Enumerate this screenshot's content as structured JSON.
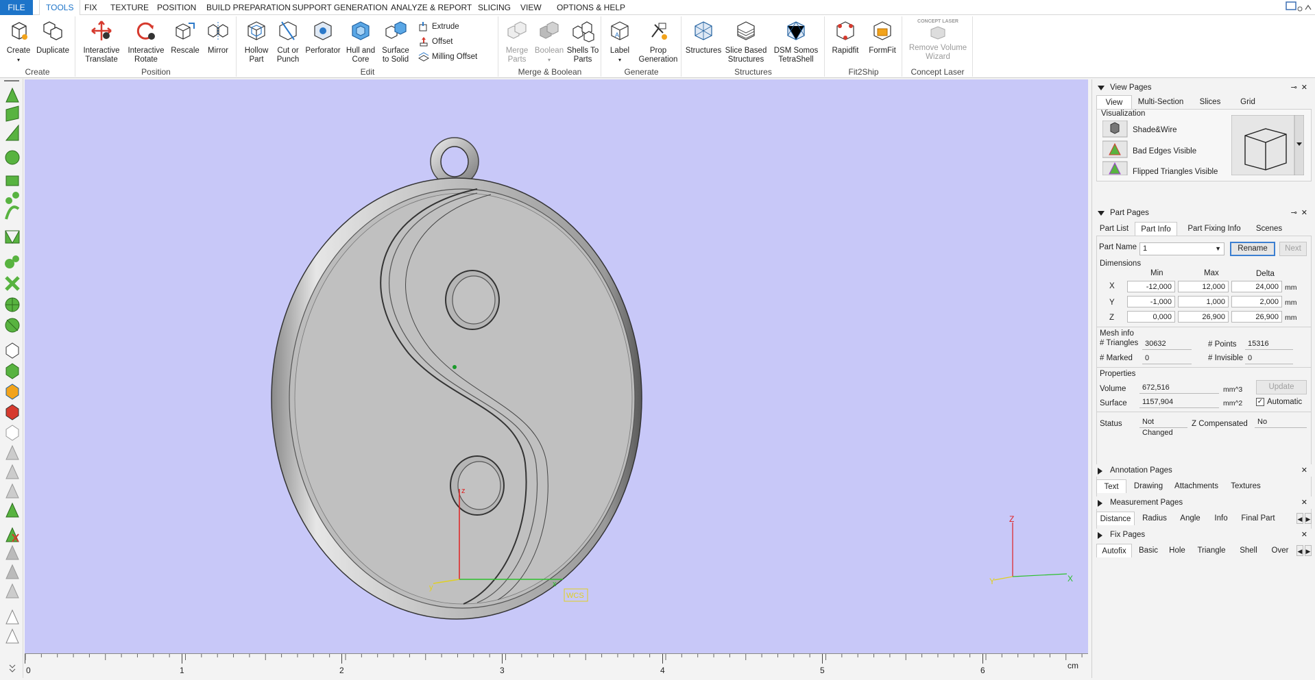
{
  "menubar": {
    "tabs": [
      "FILE",
      "TOOLS",
      "FIX",
      "TEXTURE",
      "POSITION",
      "BUILD PREPARATION",
      "SUPPORT GENERATION",
      "ANALYZE & REPORT",
      "SLICING",
      "VIEW",
      "OPTIONS & HELP"
    ],
    "active": "TOOLS"
  },
  "ribbon": {
    "create": {
      "label": "Create",
      "buttons": [
        "Create",
        "Duplicate"
      ]
    },
    "position": {
      "label": "Position",
      "buttons": [
        "Interactive Translate",
        "Interactive Rotate",
        "Rescale",
        "Mirror"
      ]
    },
    "edit": {
      "label": "Edit",
      "buttons": [
        "Hollow Part",
        "Cut or Punch",
        "Perforator",
        "Hull and Core",
        "Surface to Solid"
      ],
      "small": [
        "Extrude",
        "Offset",
        "Milling Offset"
      ]
    },
    "merge": {
      "label": "Merge & Boolean",
      "buttons": [
        "Merge Parts",
        "Boolean",
        "Shells To Parts"
      ]
    },
    "generate": {
      "label": "Generate",
      "buttons": [
        "Label",
        "Prop Generation"
      ]
    },
    "structures": {
      "label": "Structures",
      "buttons": [
        "Structures",
        "Slice Based Structures",
        "DSM Somos TetraShell"
      ]
    },
    "fit2ship": {
      "label": "Fit2Ship",
      "buttons": [
        "Rapidfit",
        "FormFit"
      ]
    },
    "concept": {
      "label": "Concept Laser",
      "buttons": [
        "Remove Volume Wizard"
      ],
      "logo_text": "CONCEPT LASER"
    }
  },
  "viewport": {
    "bg_color": "#c8c8f8",
    "axes_labels": {
      "x": "x",
      "y": "y",
      "z": "z"
    },
    "wcs_label": "WCS",
    "corner_axes": {
      "x": "X",
      "y": "Y",
      "z": "Z"
    }
  },
  "ruler": {
    "labels": [
      "0",
      "1",
      "2",
      "3",
      "4",
      "5",
      "6"
    ],
    "unit": "cm"
  },
  "view_pages": {
    "title": "View Pages",
    "tabs": [
      "View",
      "Multi-Section",
      "Slices",
      "Grid"
    ],
    "active_tab": "View",
    "group": "Visualization",
    "items": [
      "Shade&Wire",
      "Bad Edges Visible",
      "Flipped Triangles Visible"
    ]
  },
  "part_pages": {
    "title": "Part Pages",
    "tabs": [
      "Part List",
      "Part Info",
      "Part Fixing Info",
      "Scenes"
    ],
    "active_tab": "Part Info",
    "part_name_label": "Part Name",
    "part_name_value": "1",
    "rename": "Rename",
    "next": "Next",
    "dimensions": {
      "label": "Dimensions",
      "columns": [
        "Min",
        "Max",
        "Delta"
      ],
      "rows": [
        {
          "axis": "X",
          "min": "-12,000",
          "max": "12,000",
          "delta": "24,000",
          "unit": "mm"
        },
        {
          "axis": "Y",
          "min": "-1,000",
          "max": "1,000",
          "delta": "2,000",
          "unit": "mm"
        },
        {
          "axis": "Z",
          "min": "0,000",
          "max": "26,900",
          "delta": "26,900",
          "unit": "mm"
        }
      ]
    },
    "mesh_info": {
      "label": "Mesh info",
      "triangles_label": "# Triangles",
      "triangles": "30632",
      "points_label": "# Points",
      "points": "15316",
      "marked_label": "# Marked",
      "marked": "0",
      "invisible_label": "# Invisible",
      "invisible": "0"
    },
    "properties": {
      "label": "Properties",
      "volume_label": "Volume",
      "volume": "672,516",
      "volume_unit": "mm^3",
      "surface_label": "Surface",
      "surface": "1157,904",
      "surface_unit": "mm^2",
      "update": "Update",
      "automatic": "Automatic",
      "automatic_checked": true
    },
    "status_label": "Status",
    "status": "Not Changed",
    "zcomp_label": "Z Compensated",
    "zcomp": "No"
  },
  "annotation_pages": {
    "title": "Annotation Pages",
    "tabs": [
      "Text",
      "Drawing",
      "Attachments",
      "Textures"
    ],
    "active_tab": "Text"
  },
  "measurement_pages": {
    "title": "Measurement Pages",
    "tabs": [
      "Distance",
      "Radius",
      "Angle",
      "Info",
      "Final Part"
    ],
    "active_tab": "Distance"
  },
  "fix_pages": {
    "title": "Fix Pages",
    "tabs": [
      "Autofix",
      "Basic",
      "Hole",
      "Triangle",
      "Shell",
      "Over"
    ],
    "active_tab": "Autofix"
  }
}
